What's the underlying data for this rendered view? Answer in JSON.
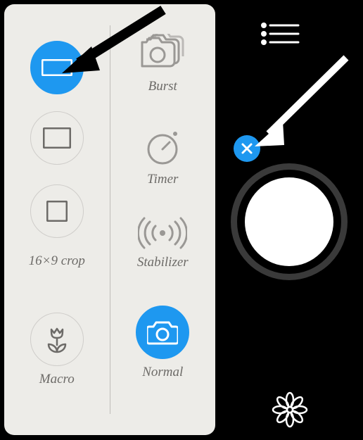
{
  "colors": {
    "accent": "#1e98f0",
    "panel": "#edece8",
    "muted": "#6d6b68",
    "shutterRing": "#3a3a3a"
  },
  "crop": {
    "items": [
      {
        "id": "crop-wide",
        "active": true,
        "icon": "rect-wide",
        "label": ""
      },
      {
        "id": "crop-43",
        "active": false,
        "icon": "rect-43",
        "label": ""
      },
      {
        "id": "crop-square",
        "active": false,
        "icon": "rect-square",
        "label": ""
      }
    ],
    "caption": "16×9 crop",
    "macro_label": "Macro"
  },
  "modes": {
    "items": [
      {
        "id": "burst",
        "icon": "burst-icon",
        "label": "Burst",
        "active": false
      },
      {
        "id": "timer",
        "icon": "timer-icon",
        "label": "Timer",
        "active": false
      },
      {
        "id": "stabilizer",
        "icon": "stabilizer-icon",
        "label": "Stabilizer",
        "active": false
      },
      {
        "id": "normal",
        "icon": "camera-icon",
        "label": "Normal",
        "active": true
      }
    ]
  },
  "right": {
    "list_icon": "list-icon",
    "close_icon": "close-icon",
    "shutter": "shutter-button",
    "gallery_icon": "flower-icon"
  }
}
